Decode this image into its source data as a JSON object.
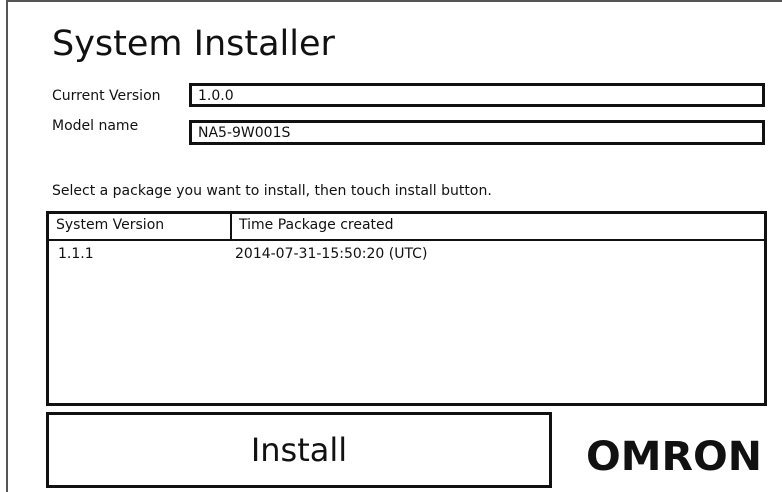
{
  "app": {
    "title": "System Installer"
  },
  "info": {
    "current_version_label": "Current Version",
    "current_version_value": "1.0.0",
    "model_name_label": "Model name",
    "model_name_value": "NA5-9W001S"
  },
  "instruction": "Select a package you want to install, then touch install button.",
  "package_table": {
    "columns": [
      "System Version",
      "Time Package created"
    ],
    "rows": [
      {
        "system_version": "1.1.1",
        "time_created": "2014-07-31-15:50:20 (UTC)"
      }
    ]
  },
  "actions": {
    "install_label": "Install"
  },
  "brand": {
    "logo_text": "OMRON"
  }
}
